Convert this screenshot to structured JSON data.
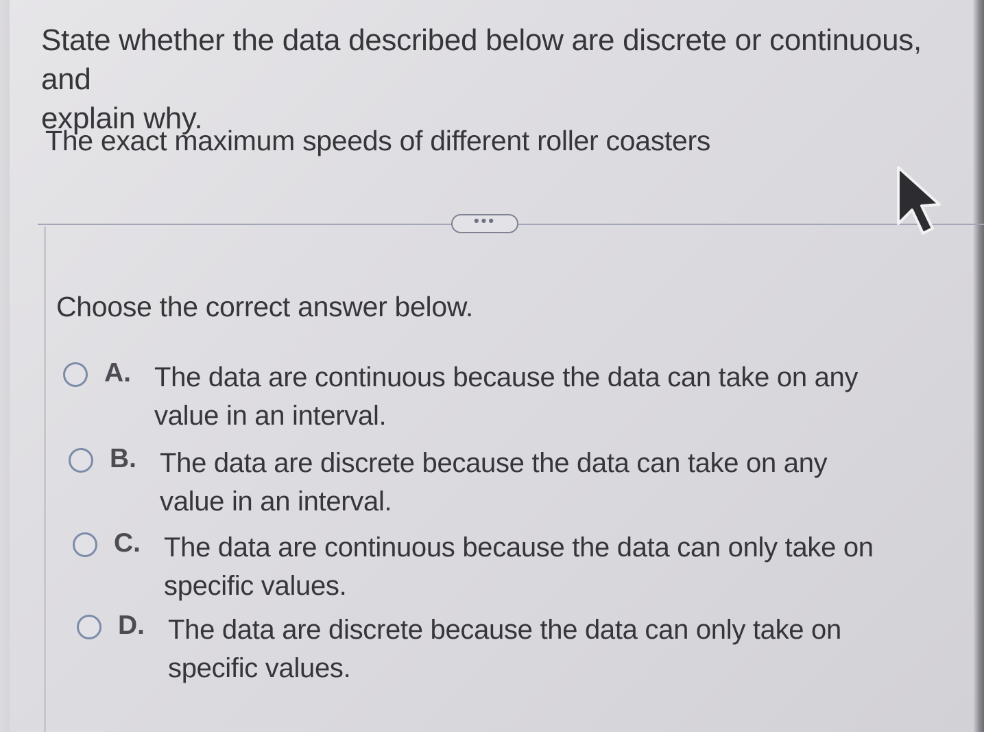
{
  "question": {
    "line1": "State whether the data described below are discrete or continuous, and",
    "line2": "explain why."
  },
  "subject": "The exact maximum speeds of different roller coasters",
  "more_button_label": "•••",
  "prompt": "Choose the correct answer below.",
  "options": [
    {
      "letter": "A.",
      "line1": "The data are continuous because the data can take on any",
      "line2": "value in an interval."
    },
    {
      "letter": "B.",
      "line1": "The data are discrete because the data can take on any",
      "line2": "value in an interval."
    },
    {
      "letter": "C.",
      "line1": "The data are continuous because the data can only take on",
      "line2": "specific values."
    },
    {
      "letter": "D.",
      "line1": "The data are discrete because the data can only take on",
      "line2": "specific values."
    }
  ],
  "colors": {
    "radio_border": "#7a8ca8",
    "text": "#36363a",
    "divider": "#a3a6b8"
  }
}
